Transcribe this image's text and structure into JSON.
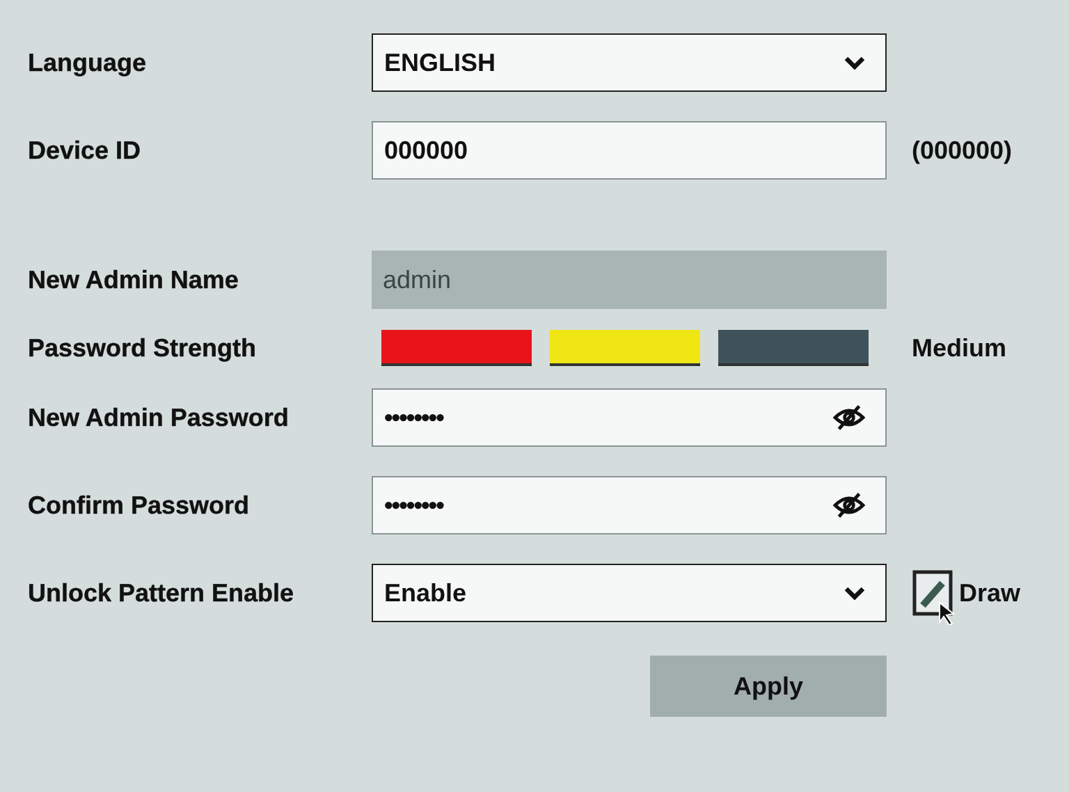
{
  "rows": [
    {
      "kind": "select",
      "label": "Language",
      "value": "ENGLISH"
    },
    {
      "kind": "text",
      "label": "Device ID",
      "value": "000000",
      "note": "(000000)"
    },
    {
      "kind": "readonly",
      "label": "New Admin Name",
      "value": "admin"
    },
    {
      "kind": "strength",
      "label": "Password Strength",
      "segments": [
        {
          "color": "#e8141a"
        },
        {
          "color": "#f0e614"
        },
        {
          "color": "#3e525a"
        }
      ],
      "note": "Medium"
    },
    {
      "kind": "password",
      "label": "New Admin Password",
      "value": "••••••••"
    },
    {
      "kind": "password",
      "label": "Confirm Password",
      "value": "••••••••"
    },
    {
      "kind": "select",
      "label": "Unlock Pattern Enable",
      "value": "Enable",
      "action": "Draw"
    }
  ],
  "apply_button": "Apply"
}
